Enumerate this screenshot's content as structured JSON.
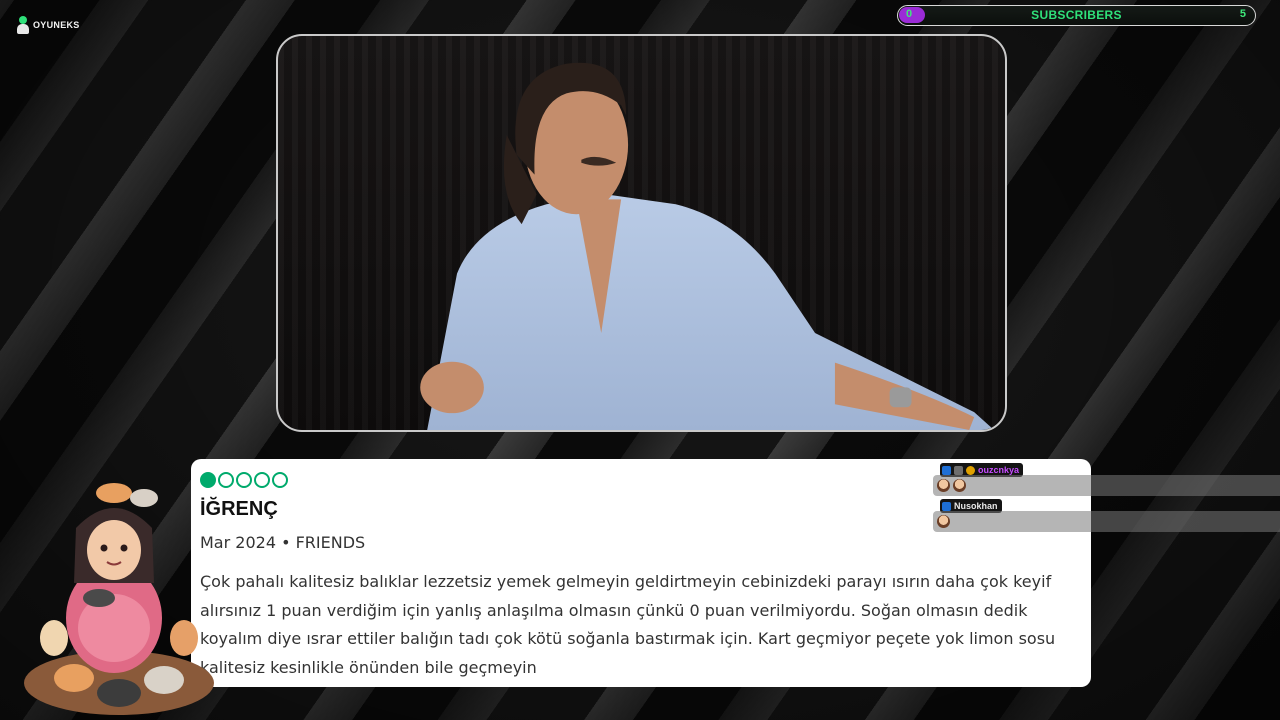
{
  "overlay": {
    "logo_text": "OYUNEKS",
    "subscribers": {
      "label": "SUBSCRIBERS",
      "current": "0",
      "goal": "5",
      "progress_fraction": 0.0
    }
  },
  "review": {
    "rating": 1,
    "rating_max": 5,
    "title": "İĞRENÇ",
    "meta": "Mar 2024 • FRIENDS",
    "body": "Çok pahalı kalitesiz balıklar lezzetsiz yemek gelmeyin geldirtmeyin cebinizdeki parayı ısırın daha çok keyif alırsınız 1 puan verdiğim için yanlış anlaşılma olmasın çünkü 0 puan verilmiyordu. Soğan olmasın dedik koyalım diye ısrar ettiler balığın tadı çok kötü soğanla bastırmak için. Kart geçmiyor peçete yok limon sosu kalitesiz kesinlikle önünden bile geçmeyin",
    "accent": "#00aa6c"
  },
  "chat": [
    {
      "user": "ouzcnkya",
      "color": "#c64bff",
      "badges": [
        "prime-icon",
        "sub-icon",
        "bits-icon"
      ],
      "emotes": 2
    },
    {
      "user": "Nusokhan",
      "color": "#e8e8e8",
      "badges": [
        "prime-icon"
      ],
      "emotes": 1
    }
  ],
  "colors": {
    "brand_green": "#2fe07a",
    "sub_purple": "#9b2bd6"
  }
}
